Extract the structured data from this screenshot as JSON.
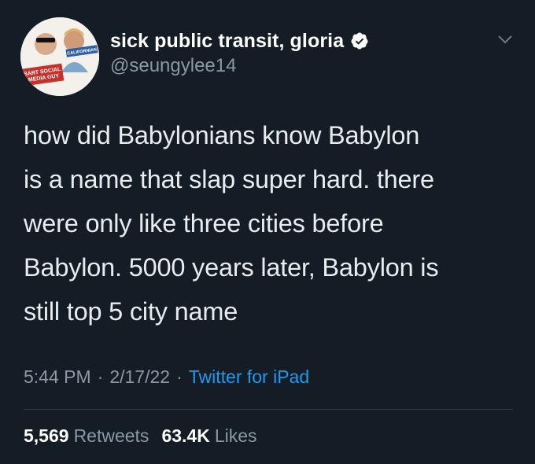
{
  "author": {
    "display_name": "sick public transit, gloria",
    "handle": "@seungylee14",
    "verified": true,
    "avatar_banner_left": "BART SOCIAL MEDIA GUY",
    "avatar_banner_right": "CALIFORNIAN"
  },
  "tweet": {
    "text": "how did Babylonians know Babylon\nis a name that slap super hard. there\nwere only like three cities before\nBabylon. 5000 years later, Babylon is\nstill top 5 city name"
  },
  "meta": {
    "time": "5:44 PM",
    "separator": "·",
    "date": "2/17/22",
    "source": "Twitter for iPad"
  },
  "stats": {
    "retweets_count": "5,569",
    "retweets_label": "Retweets",
    "likes_count": "63.4K",
    "likes_label": "Likes"
  },
  "colors": {
    "background": "#141c26",
    "text": "#e8ecef",
    "muted": "#8b98a5",
    "link": "#1d9bf0",
    "verified": "#ffffff"
  },
  "icons": {
    "verified": "verified-badge-icon",
    "caret": "chevron-down-icon"
  }
}
